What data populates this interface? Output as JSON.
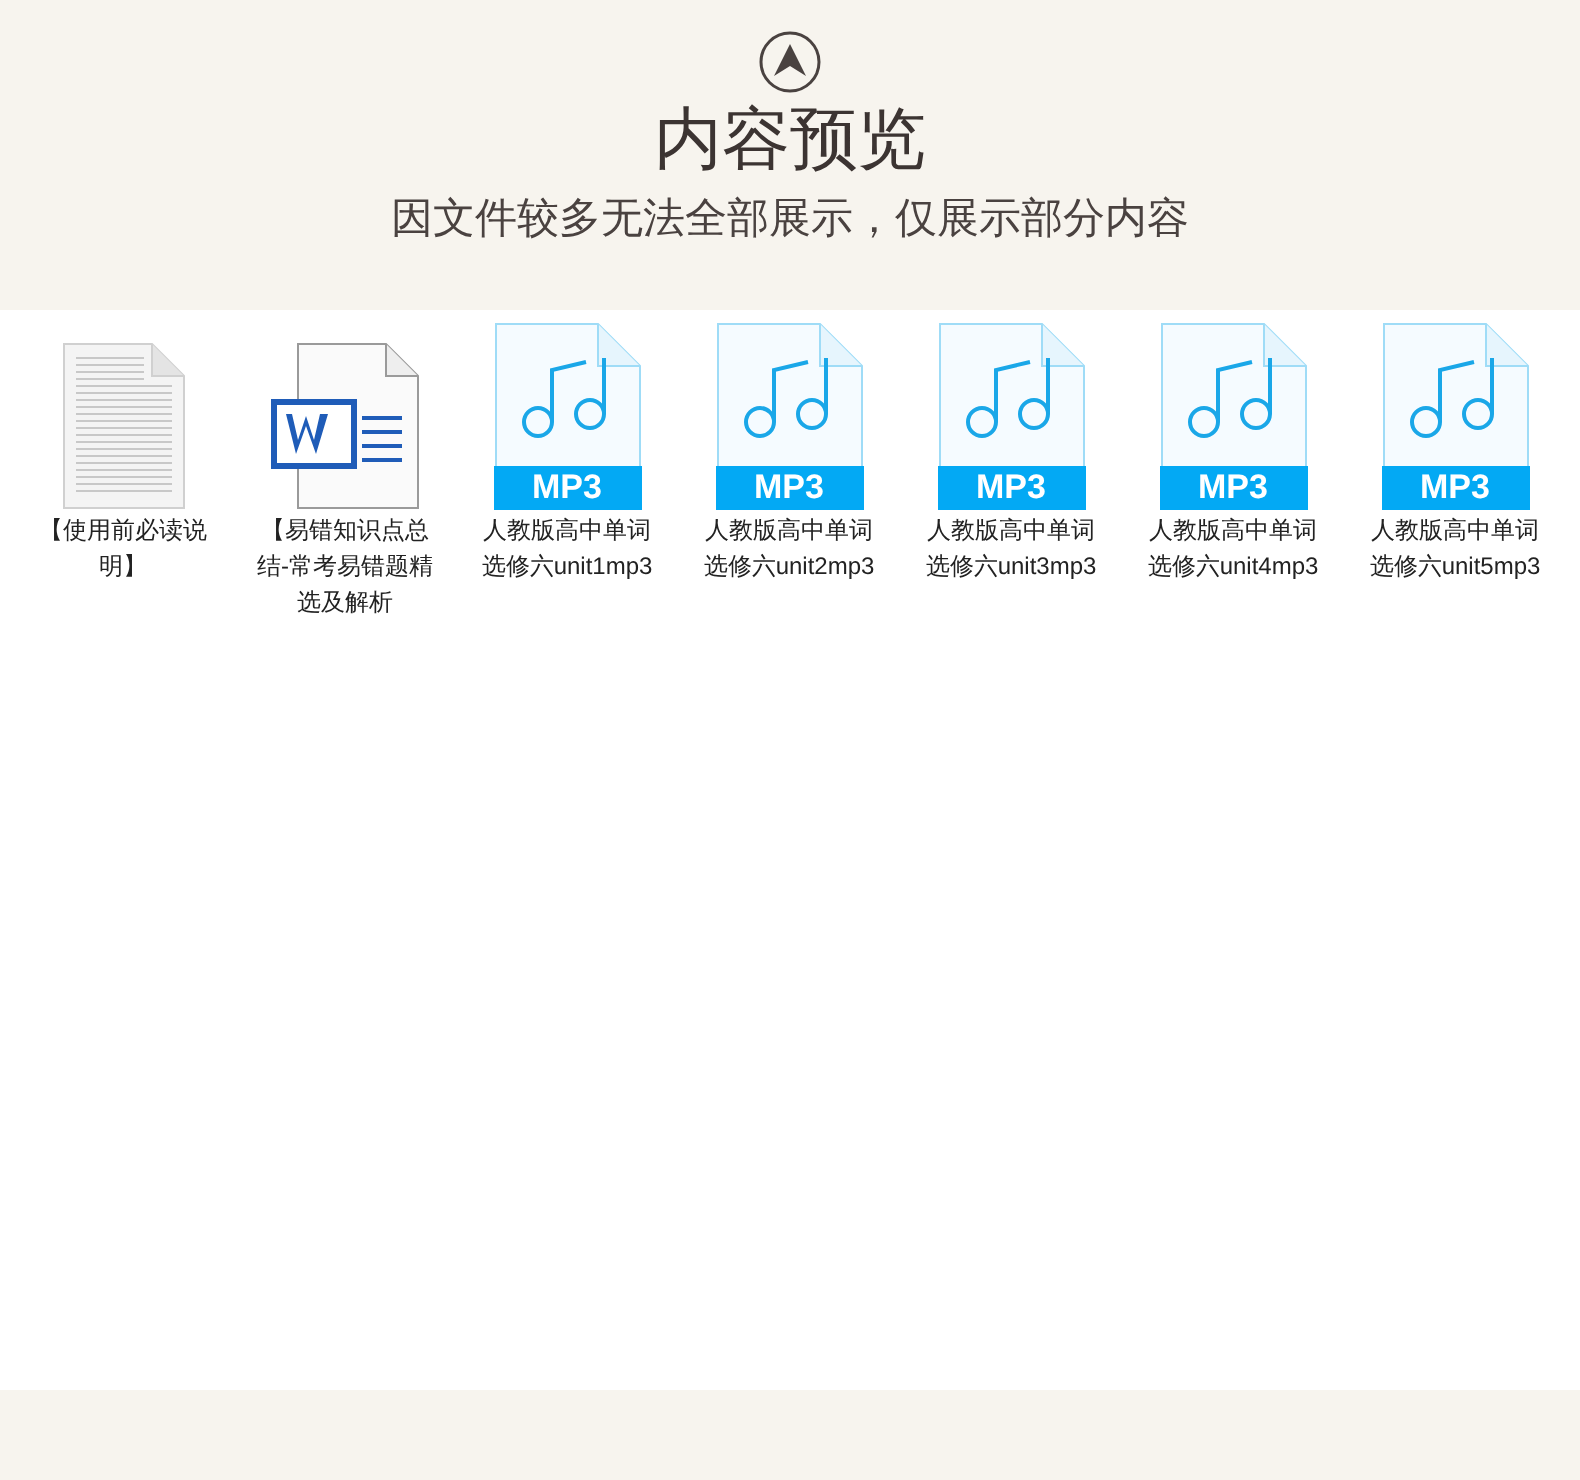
{
  "header": {
    "title": "内容预览",
    "subtitle": "因文件较多无法全部展示，仅展示部分内容"
  },
  "files": [
    {
      "kind": "text",
      "name": "【使用前必读说明】"
    },
    {
      "kind": "word",
      "name": "【易错知识点总结-常考易错题精选及解析"
    },
    {
      "kind": "mp3",
      "badge": "MP3",
      "name": "人教版高中单词选修六unit1mp3"
    },
    {
      "kind": "mp3",
      "badge": "MP3",
      "name": "人教版高中单词选修六unit2mp3"
    },
    {
      "kind": "mp3",
      "badge": "MP3",
      "name": "人教版高中单词选修六unit3mp3"
    },
    {
      "kind": "mp3",
      "badge": "MP3",
      "name": "人教版高中单词选修六unit4mp3"
    },
    {
      "kind": "mp3",
      "badge": "MP3",
      "name": "人教版高中单词选修六unit5mp3"
    }
  ]
}
